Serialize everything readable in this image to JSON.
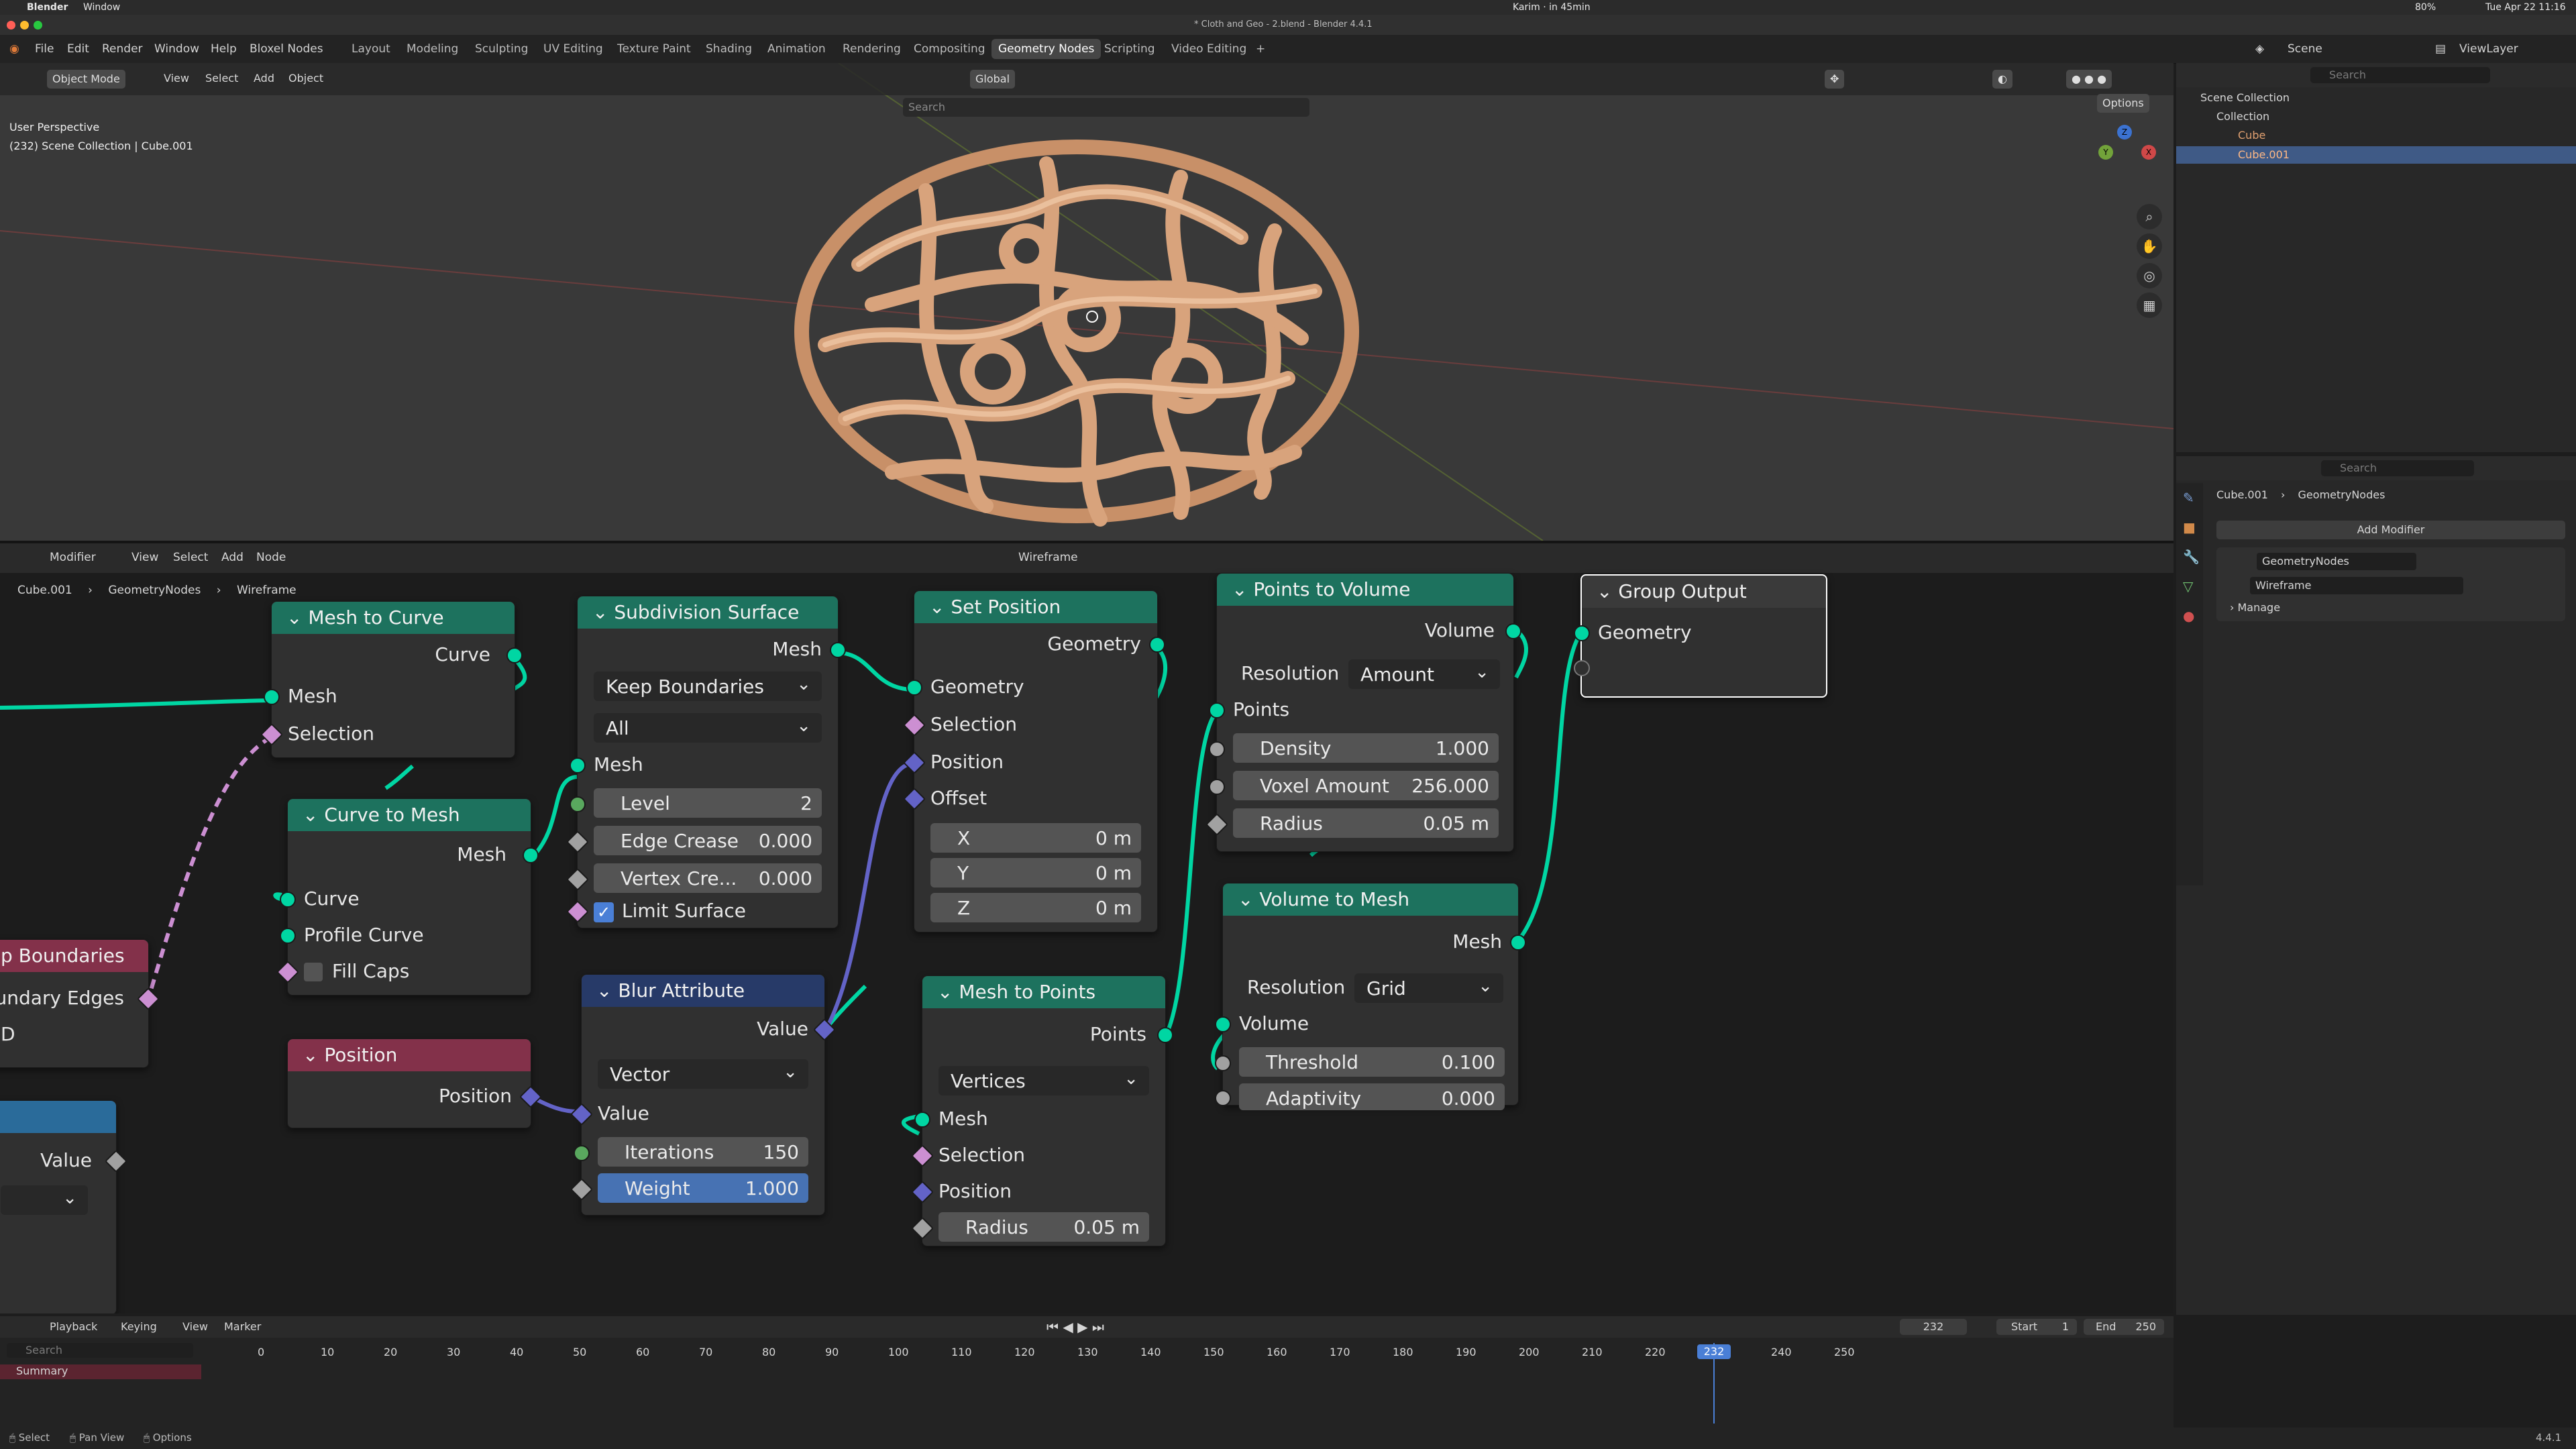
{
  "mac_menubar": {
    "app": "Blender",
    "window": "Window",
    "status_center": "Karim · in 45min",
    "clock": "Tue Apr 22 11:16",
    "battery": "80%"
  },
  "titlebar": {
    "title": "* Cloth and Geo - 2.blend - Blender 4.4.1"
  },
  "top_menu": [
    "File",
    "Edit",
    "Render",
    "Window",
    "Help",
    "Bloxel Nodes"
  ],
  "workspaces": [
    "Layout",
    "Modeling",
    "Sculpting",
    "UV Editing",
    "Texture Paint",
    "Shading",
    "Animation",
    "Rendering",
    "Compositing",
    "Geometry Nodes",
    "Scripting",
    "Video Editing"
  ],
  "active_workspace": "Geometry Nodes",
  "scene_selector": "Scene",
  "viewlayer_selector": "ViewLayer",
  "viewport": {
    "mode": "Object Mode",
    "menus": [
      "View",
      "Select",
      "Add",
      "Object"
    ],
    "transform": "Global",
    "search_placeholder": "Search",
    "options": "Options",
    "overlay_line1": "User Perspective",
    "overlay_line2": "(232) Scene Collection | Cube.001",
    "gizmo_axes": [
      "Z",
      "Y",
      "X"
    ]
  },
  "outliner": {
    "search_placeholder": "Search",
    "items": [
      {
        "label": "Scene Collection"
      },
      {
        "label": "Collection"
      },
      {
        "label": "Cube"
      },
      {
        "label": "Cube.001"
      }
    ]
  },
  "properties": {
    "search_placeholder": "Search",
    "breadcrumb": [
      "Cube.001",
      "GeometryNodes"
    ],
    "add_modifier": "Add Modifier",
    "modifier_name": "GeometryNodes",
    "node_group": "Wireframe",
    "manage": "Manage"
  },
  "node_editor": {
    "menus": [
      "Modifier",
      "View",
      "Select",
      "Add",
      "Node"
    ],
    "node_group": "Wireframe",
    "breadcrumb": [
      "Cube.001",
      "GeometryNodes",
      "Wireframe"
    ],
    "nodes": {
      "mesh_to_curve": {
        "title": "Mesh to Curve",
        "out": "Curve",
        "in1": "Mesh",
        "in2": "Selection"
      },
      "curve_to_mesh": {
        "title": "Curve to Mesh",
        "out": "Mesh",
        "in1": "Curve",
        "in2": "Profile Curve",
        "in3": "Fill Caps"
      },
      "subdivision": {
        "title": "Subdivision Surface",
        "out": "Mesh",
        "dd1": "Keep Boundaries",
        "dd2": "All",
        "in_mesh": "Mesh",
        "level_label": "Level",
        "level": "2",
        "edge_label": "Edge Crease",
        "edge": "0.000",
        "vertex_label": "Vertex Cre...",
        "vertex": "0.000",
        "limit": "Limit Surface"
      },
      "set_position": {
        "title": "Set Position",
        "out": "Geometry",
        "in1": "Geometry",
        "in2": "Selection",
        "in3": "Position",
        "in4": "Offset",
        "x_label": "X",
        "x": "0 m",
        "y_label": "Y",
        "y": "0 m",
        "z_label": "Z",
        "z": "0 m"
      },
      "points_to_volume": {
        "title": "Points to Volume",
        "out": "Volume",
        "res_label": "Resolution",
        "res": "Amount",
        "in_points": "Points",
        "density_label": "Density",
        "density": "1.000",
        "voxel_label": "Voxel Amount",
        "voxel": "256.000",
        "radius_label": "Radius",
        "radius": "0.05 m"
      },
      "group_output": {
        "title": "Group Output",
        "in1": "Geometry"
      },
      "blur": {
        "title": "Blur Attribute",
        "out": "Value",
        "dd": "Vector",
        "in_value": "Value",
        "iter_label": "Iterations",
        "iter": "150",
        "weight_label": "Weight",
        "weight": "1.000"
      },
      "mesh_to_points": {
        "title": "Mesh to Points",
        "out": "Points",
        "dd": "Vertices",
        "in1": "Mesh",
        "in2": "Selection",
        "in3": "Position",
        "radius_label": "Radius",
        "radius": "0.05 m"
      },
      "volume_to_mesh": {
        "title": "Volume to Mesh",
        "out": "Mesh",
        "res_label": "Resolution",
        "res": "Grid",
        "in_volume": "Volume",
        "thr_label": "Threshold",
        "thr": "0.100",
        "adapt_label": "Adaptivity",
        "adapt": "0.000"
      },
      "position": {
        "title": "Position",
        "out": "Position"
      },
      "boundaries_partial": {
        "title": "p Boundaries",
        "out": "oundary Edges",
        "extra": "D"
      },
      "value_partial": {
        "out": "Value"
      }
    }
  },
  "timeline": {
    "menus": [
      "Playback",
      "Keying",
      "View",
      "Marker"
    ],
    "search_placeholder": "Search",
    "current_frame": "232",
    "start_label": "Start",
    "start": "1",
    "end_label": "End",
    "end": "250",
    "summary": "Summary",
    "ticks": [
      "0",
      "10",
      "20",
      "30",
      "40",
      "50",
      "60",
      "70",
      "80",
      "90",
      "100",
      "110",
      "120",
      "130",
      "140",
      "150",
      "160",
      "170",
      "180",
      "190",
      "200",
      "210",
      "220",
      "230",
      "240",
      "250"
    ]
  },
  "statusbar": {
    "select": "Select",
    "pan": "Pan View",
    "options": "Options",
    "version": "4.4.1"
  }
}
